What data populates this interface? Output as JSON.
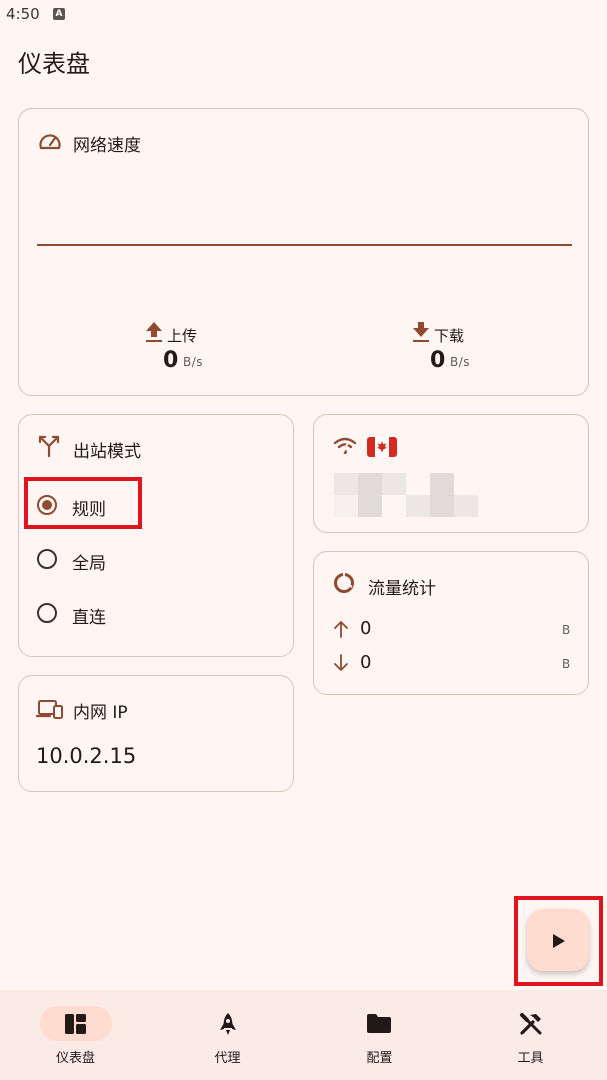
{
  "status_bar": {
    "time": "4:50",
    "indicator": "A"
  },
  "page_title": "仪表盘",
  "network_speed": {
    "title": "网络速度",
    "icon": "speedometer-icon",
    "upload": {
      "label": "上传",
      "value": "0",
      "unit": "B/s"
    },
    "download": {
      "label": "下载",
      "value": "0",
      "unit": "B/s"
    }
  },
  "outbound_mode": {
    "title": "出站模式",
    "icon": "fork-icon",
    "options": [
      {
        "label": "规则",
        "selected": true
      },
      {
        "label": "全局",
        "selected": false
      },
      {
        "label": "直连",
        "selected": false
      }
    ]
  },
  "proxy_node": {
    "icon": "wifi-icon",
    "flag": "canada-flag"
  },
  "traffic": {
    "title": "流量统计",
    "icon": "donut-chart-icon",
    "upload_value": "0",
    "upload_unit": "B",
    "download_value": "0",
    "download_unit": "B"
  },
  "intranet_ip": {
    "title": "内网 IP",
    "icon": "devices-icon",
    "value": "10.0.2.15"
  },
  "fab": {
    "icon": "play-icon"
  },
  "bottom_nav": {
    "items": [
      {
        "label": "仪表盘",
        "icon": "dashboard-icon",
        "active": true
      },
      {
        "label": "代理",
        "icon": "rocket-icon",
        "active": false
      },
      {
        "label": "配置",
        "icon": "folder-icon",
        "active": false
      },
      {
        "label": "工具",
        "icon": "tools-icon",
        "active": false
      }
    ]
  },
  "colors": {
    "background": "#fff6f3",
    "accent": "#8f4a32",
    "highlight": "#e0141f",
    "fab": "#ffdbd0"
  }
}
